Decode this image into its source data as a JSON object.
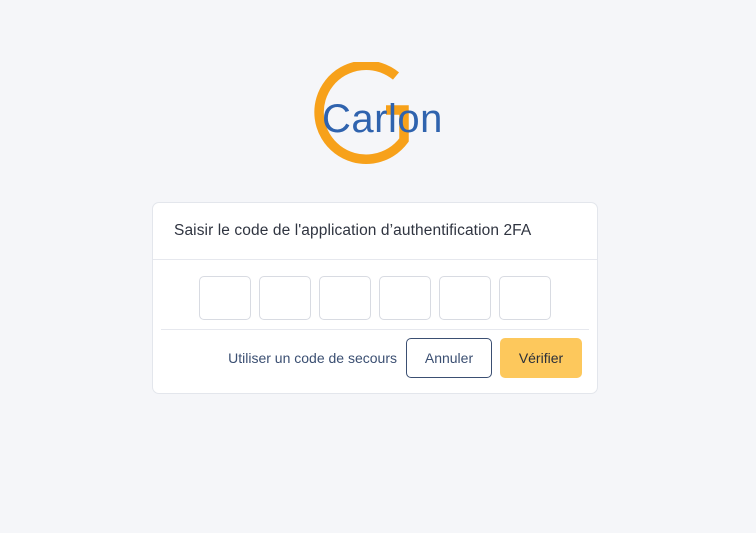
{
  "logo": {
    "wordmark": "Carlon",
    "colors": {
      "ring": "#f7a11a",
      "text": "#2f63ae"
    }
  },
  "card": {
    "title": "Saisir le code de l'application d’authentification 2FA",
    "code_inputs": [
      "",
      "",
      "",
      "",
      "",
      ""
    ],
    "backup_link": "Utiliser un code de secours",
    "cancel_label": "Annuler",
    "verify_label": "Vérifier"
  },
  "colors": {
    "background": "#f5f6f9",
    "primary_button": "#fdc85c",
    "secondary_border": "#3b4f72"
  }
}
